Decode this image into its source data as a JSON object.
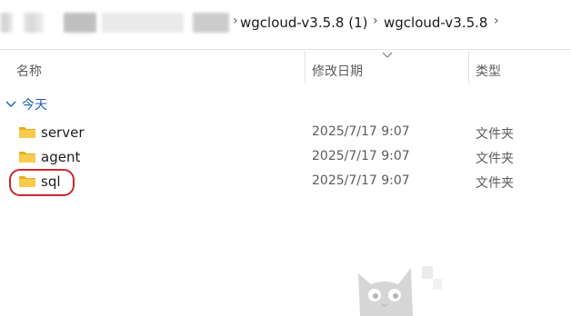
{
  "breadcrumbs": {
    "items": [
      "wgcloud-v3.5.8 (1)",
      "wgcloud-v3.5.8"
    ]
  },
  "columns": {
    "name": "名称",
    "modified": "修改日期",
    "type": "类型"
  },
  "group": {
    "label": "今天"
  },
  "files": [
    {
      "name": "server",
      "modified": "2025/7/17 9:07",
      "type": "文件夹"
    },
    {
      "name": "agent",
      "modified": "2025/7/17 9:07",
      "type": "文件夹"
    },
    {
      "name": "sql",
      "modified": "2025/7/17 9:07",
      "type": "文件夹"
    }
  ],
  "colors": {
    "folder": "#f4c542",
    "highlight": "#d1252c",
    "group": "#1a5fb4"
  },
  "icons": {
    "folder": "folder-icon",
    "chevron": "chevron-right-icon"
  }
}
